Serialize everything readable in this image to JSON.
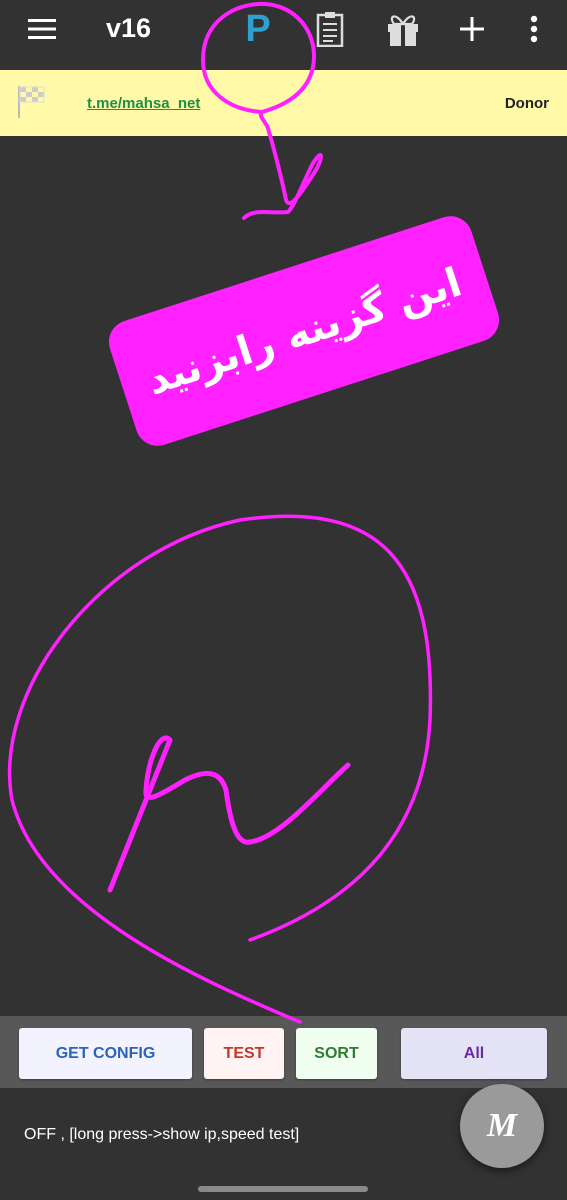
{
  "appbar": {
    "title": "v16",
    "icons": [
      "menu-icon",
      "p-icon",
      "clipboard-icon",
      "gift-icon",
      "plus-icon",
      "more-vert-icon"
    ],
    "p_letter": "P",
    "accent": "#2f9fcf"
  },
  "banner": {
    "link": "t.me/mahsa_net",
    "donor": "Donor",
    "background": "#fff9a8"
  },
  "annotation": {
    "callout_text": "این گزینه رابزنید",
    "color": "#ff21ff"
  },
  "toolbar": {
    "get_config": "GET CONFIG",
    "test": "TEST",
    "sort": "SORT",
    "all": "All"
  },
  "status": {
    "text": "OFF , [long press->show ip,speed test]"
  },
  "fab": {
    "label": "M"
  }
}
